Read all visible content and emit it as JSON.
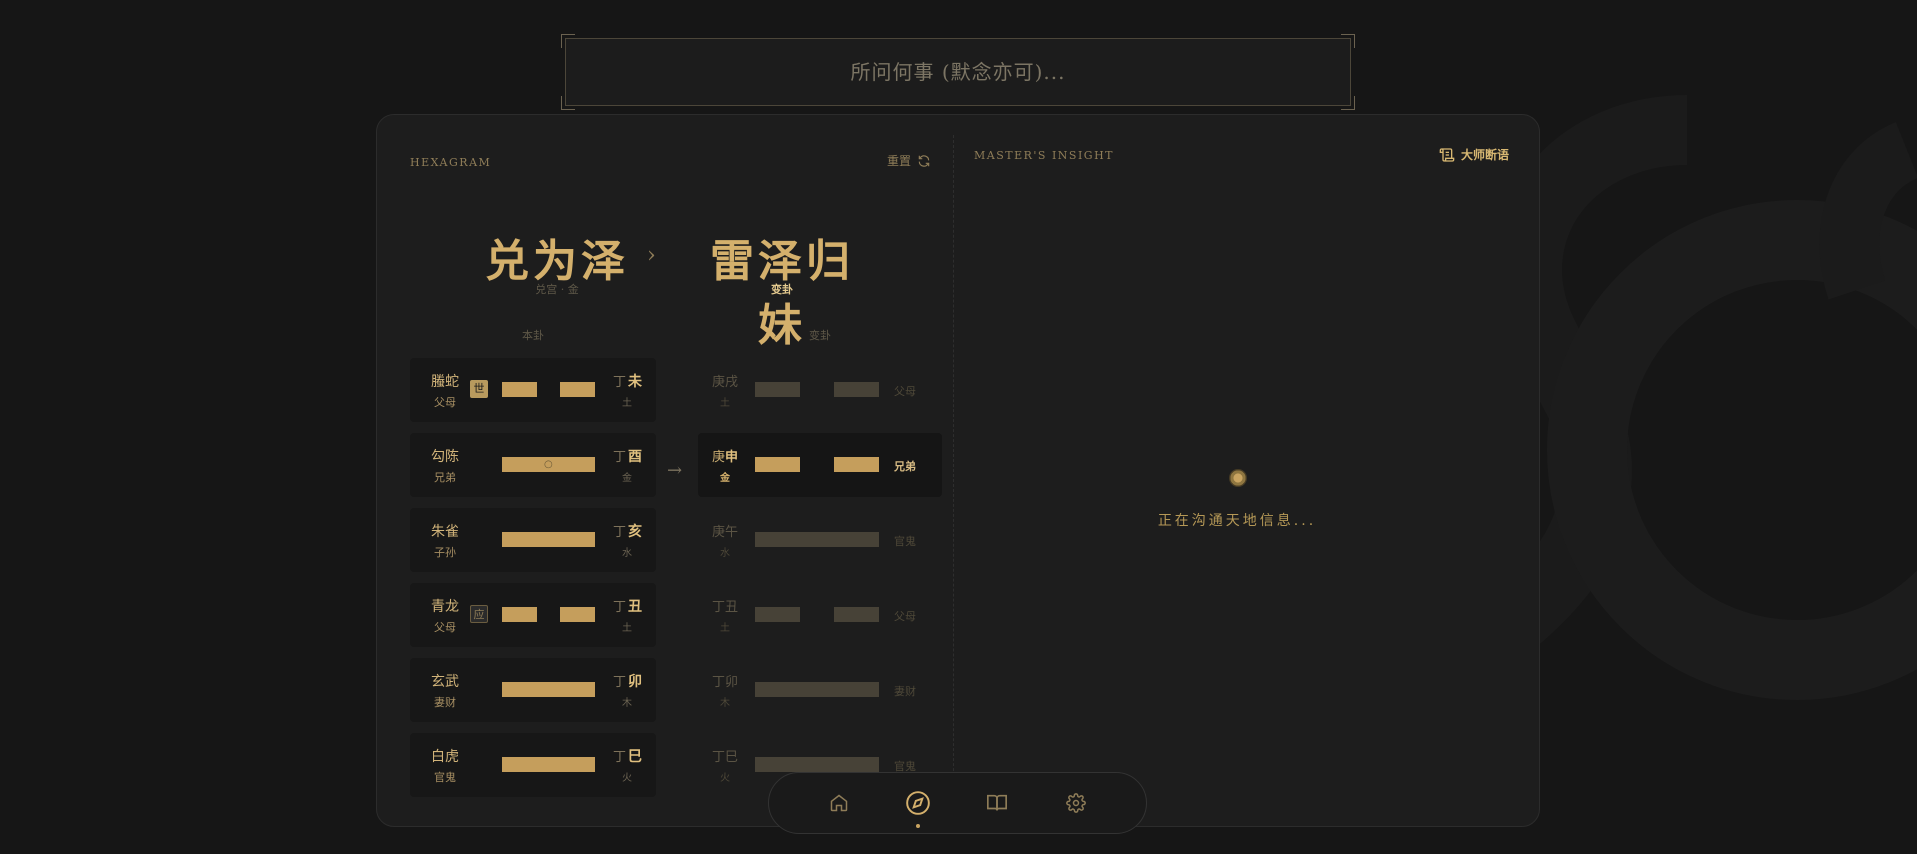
{
  "question": {
    "placeholder": "所问何事 (默念亦可)..."
  },
  "hexagram_panel": {
    "label": "HEXAGRAM",
    "reset_label": "重置",
    "main_name": "兑为泽",
    "main_sub": "兑宫 · 金",
    "changed_name": "雷泽归妹",
    "changed_sub": "变卦",
    "main_col_head": "本卦",
    "changed_col_head": "变卦",
    "lines": [
      {
        "god": "螣蛇",
        "relation": "父母",
        "badge": "世",
        "type": "yin",
        "stem": "丁",
        "branch": "未",
        "element": "土"
      },
      {
        "god": "勾陈",
        "relation": "兄弟",
        "badge": "",
        "type": "yang",
        "moving": "○",
        "stem": "丁",
        "branch": "酉",
        "element": "金"
      },
      {
        "god": "朱雀",
        "relation": "子孙",
        "badge": "",
        "type": "yang",
        "stem": "丁",
        "branch": "亥",
        "element": "水"
      },
      {
        "god": "青龙",
        "relation": "父母",
        "badge": "应",
        "type": "yin",
        "stem": "丁",
        "branch": "丑",
        "element": "土"
      },
      {
        "god": "玄武",
        "relation": "妻财",
        "badge": "",
        "type": "yang",
        "stem": "丁",
        "branch": "卯",
        "element": "木"
      },
      {
        "god": "白虎",
        "relation": "官鬼",
        "badge": "",
        "type": "yang",
        "stem": "丁",
        "branch": "巳",
        "element": "火"
      }
    ],
    "changed_lines": [
      {
        "stem": "庚",
        "branch": "戌",
        "element": "土",
        "type": "yin",
        "relation": "父母"
      },
      {
        "stem": "庚",
        "branch": "申",
        "element": "金",
        "type": "yin",
        "relation": "兄弟"
      },
      {
        "stem": "庚",
        "branch": "午",
        "element": "水",
        "type": "yang",
        "relation": "官鬼"
      },
      {
        "stem": "丁",
        "branch": "丑",
        "element": "土",
        "type": "yin",
        "relation": "父母"
      },
      {
        "stem": "丁",
        "branch": "卯",
        "element": "木",
        "type": "yang",
        "relation": "妻财"
      },
      {
        "stem": "丁",
        "branch": "巳",
        "element": "火",
        "type": "yang",
        "relation": "官鬼"
      }
    ]
  },
  "insight_panel": {
    "label": "MASTER'S INSIGHT",
    "master_button": "大师断语",
    "loading_text": "正在沟通天地信息..."
  },
  "nav": {
    "items": [
      {
        "icon": "home-icon"
      },
      {
        "icon": "compass-icon",
        "active": true
      },
      {
        "icon": "book-icon"
      },
      {
        "icon": "gear-icon"
      }
    ]
  },
  "colors": {
    "accent": "#c59e5c",
    "background": "#161616",
    "panel": "#1d1d1d"
  }
}
